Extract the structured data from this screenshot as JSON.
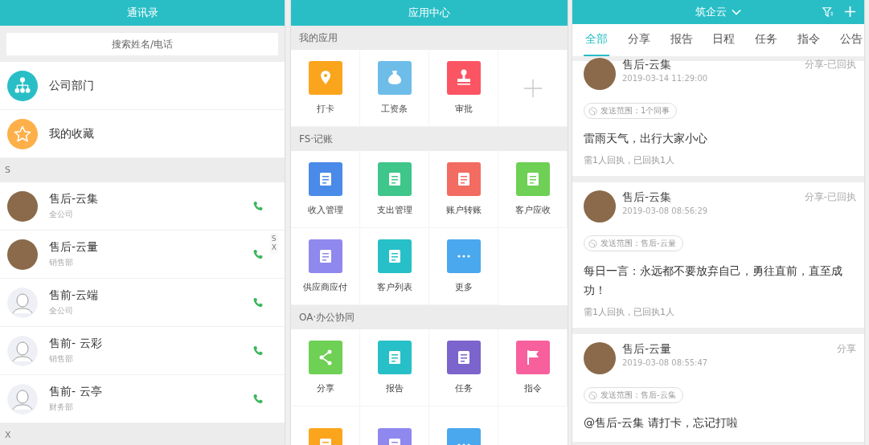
{
  "contacts_screen": {
    "title": "通讯录",
    "search": {
      "placeholder": "搜索姓名/电话"
    },
    "shortcuts": [
      {
        "label": "公司部门",
        "color": "#29bec6",
        "kind": "org"
      },
      {
        "label": "我的收藏",
        "color": "#fdb04a",
        "kind": "star"
      }
    ],
    "sections": [
      {
        "letter": "S",
        "contacts": [
          {
            "name": "售后-云集",
            "dept": "全公司",
            "kind": "photo"
          },
          {
            "name": "售后-云量",
            "dept": "销售部",
            "kind": "photo"
          },
          {
            "name": "售前-云端",
            "dept": "全公司",
            "kind": "default"
          },
          {
            "name": "售前- 云彩",
            "dept": "销售部",
            "kind": "default"
          },
          {
            "name": "售前- 云亭",
            "dept": "财务部",
            "kind": "default"
          }
        ]
      },
      {
        "letter": "X"
      }
    ],
    "index_letters": [
      "S",
      "X"
    ]
  },
  "apps_screen": {
    "title": "应用中心",
    "sections": [
      {
        "title": "我的应用",
        "apps": [
          {
            "label": "打卡",
            "color": "#fba51d",
            "kind": "app"
          },
          {
            "label": "工资条",
            "color": "#6ebde9",
            "kind": "app"
          },
          {
            "label": "审批",
            "color": "#fb5563",
            "kind": "app"
          },
          {
            "kind": "add"
          }
        ]
      },
      {
        "title": "FS·记账",
        "apps": [
          {
            "label": "收入管理",
            "color": "#4a8ae8",
            "kind": "app"
          },
          {
            "label": "支出管理",
            "color": "#3fc68a",
            "kind": "app"
          },
          {
            "label": "账户转账",
            "color": "#f26c62",
            "kind": "app"
          },
          {
            "label": "客户应收",
            "color": "#6ed054",
            "kind": "app"
          },
          {
            "label": "供应商应付",
            "color": "#8f88ee",
            "kind": "app"
          },
          {
            "label": "客户列表",
            "color": "#27c0c8",
            "kind": "app"
          },
          {
            "label": "更多",
            "color": "#4aa8ee",
            "kind": "app"
          }
        ]
      },
      {
        "title": "OA·办公协同",
        "apps": [
          {
            "label": "分享",
            "color": "#6ed054",
            "kind": "app"
          },
          {
            "label": "报告",
            "color": "#27c0c8",
            "kind": "app"
          },
          {
            "label": "任务",
            "color": "#7b64cc",
            "kind": "app"
          },
          {
            "label": "指令",
            "color": "#f7609c",
            "kind": "app"
          },
          {
            "color": "#fba51d",
            "kind": "app"
          },
          {
            "color": "#8f88ee",
            "kind": "app"
          },
          {
            "color": "#4aa8ee",
            "kind": "app"
          }
        ]
      }
    ]
  },
  "feed_screen": {
    "title": "筑企云",
    "tabs": [
      {
        "label": "全部",
        "selected": true
      },
      {
        "label": "分享",
        "selected": false
      },
      {
        "label": "报告",
        "selected": false
      },
      {
        "label": "日程",
        "selected": false
      },
      {
        "label": "任务",
        "selected": false
      },
      {
        "label": "指令",
        "selected": false
      },
      {
        "label": "公告",
        "selected": false
      }
    ],
    "posts": [
      {
        "author": "售后-云集",
        "time": "2019-03-14 11:29:00",
        "status": "分享-已回执",
        "scope": "发送范围：1个同事",
        "content": "雷雨天气，出行大家小心",
        "receipt": "需1人回执，已回执1人"
      },
      {
        "author": "售后-云集",
        "time": "2019-03-08 08:56:29",
        "status": "分享-已回执",
        "scope": "发送范围：售后-云量",
        "content": "每日一言：永远都不要放弃自己，勇往直前，直至成功！",
        "receipt": "需1人回执，已回执1人"
      },
      {
        "author": "售后-云量",
        "time": "2019-03-08 08:55:47",
        "status": "分享",
        "scope": "发送范围：售后-云集",
        "content": "@售后-云集 请打卡，忘记打啦"
      }
    ]
  }
}
